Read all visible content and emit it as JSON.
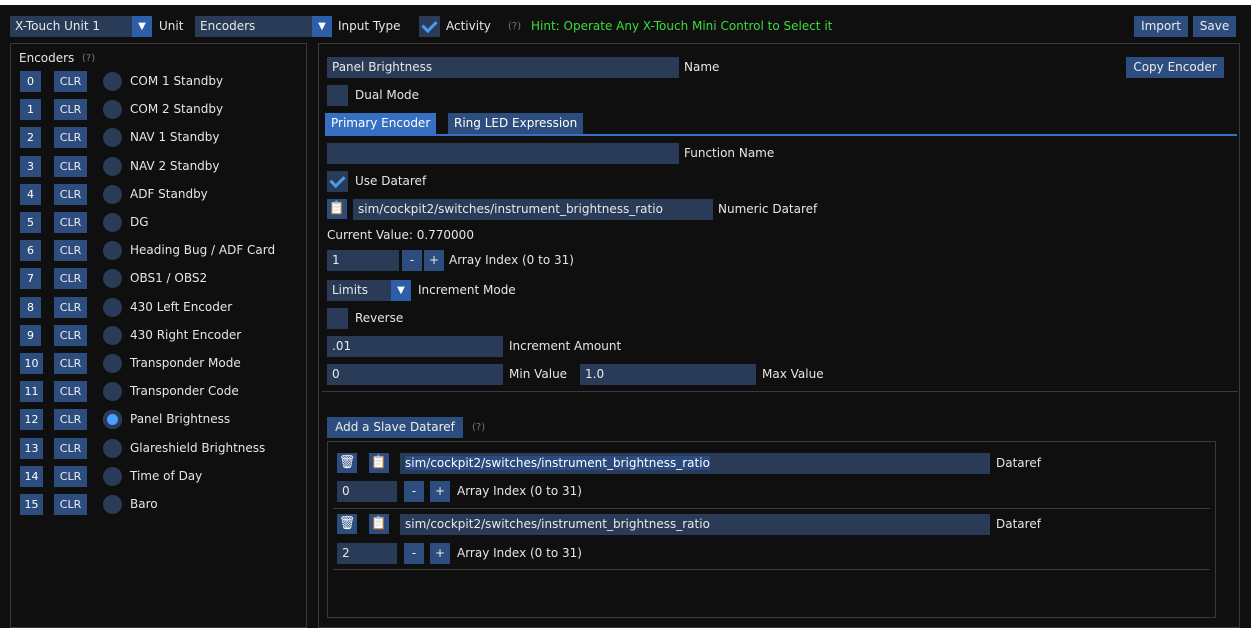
{
  "toolbar": {
    "unit_value": "X-Touch Unit 1",
    "unit_label": "Unit",
    "input_type_value": "Encoders",
    "input_type_label": "Input Type",
    "activity_label": "Activity",
    "help": "(?)",
    "hint": "Hint: Operate Any X-Touch Mini Control to Select it",
    "import_label": "Import",
    "save_label": "Save"
  },
  "sidebar": {
    "title": "Encoders",
    "help": "(?)",
    "clr_label": "CLR",
    "items": [
      {
        "index": "0",
        "name": "COM 1 Standby"
      },
      {
        "index": "1",
        "name": "COM 2 Standby"
      },
      {
        "index": "2",
        "name": "NAV 1 Standby"
      },
      {
        "index": "3",
        "name": "NAV 2 Standby"
      },
      {
        "index": "4",
        "name": "ADF Standby"
      },
      {
        "index": "5",
        "name": "DG"
      },
      {
        "index": "6",
        "name": "Heading Bug / ADF Card"
      },
      {
        "index": "7",
        "name": "OBS1 / OBS2"
      },
      {
        "index": "8",
        "name": "430 Left Encoder"
      },
      {
        "index": "9",
        "name": "430 Right Encoder"
      },
      {
        "index": "10",
        "name": "Transponder Mode"
      },
      {
        "index": "11",
        "name": "Transponder Code"
      },
      {
        "index": "12",
        "name": "Panel Brightness"
      },
      {
        "index": "13",
        "name": "Glareshield Brightness"
      },
      {
        "index": "14",
        "name": "Time of Day"
      },
      {
        "index": "15",
        "name": "Baro"
      }
    ],
    "selected_index": 12
  },
  "editor": {
    "name_value": "Panel Brightness",
    "name_label": "Name",
    "copy_label": "Copy Encoder",
    "dual_mode_label": "Dual Mode",
    "tabs": [
      "Primary Encoder",
      "Ring LED Expression"
    ],
    "function_name_value": "",
    "function_name_label": "Function Name",
    "use_dataref_label": "Use Dataref",
    "dataref_value": "sim/cockpit2/switches/instrument_brightness_ratio",
    "dataref_label": "Numeric Dataref",
    "current_value_text": "Current Value: 0.770000",
    "array_index_value": "1",
    "minus_label": "-",
    "plus_label": "+",
    "array_index_label": "Array Index (0 to 31)",
    "increment_mode_value": "Limits",
    "increment_mode_label": "Increment Mode",
    "reverse_label": "Reverse",
    "increment_amount_value": ".01",
    "increment_amount_label": "Increment Amount",
    "min_value": "0",
    "min_label": "Min Value",
    "max_value": "1.0",
    "max_label": "Max Value"
  },
  "slaves": {
    "add_label": "Add a Slave Dataref",
    "help": "(?)",
    "items": [
      {
        "dataref": "sim/cockpit2/switches/instrument_brightness_ratio",
        "dataref_label": "Dataref",
        "index": "0",
        "index_label": "Array Index (0 to 31)"
      },
      {
        "dataref": "sim/cockpit2/switches/instrument_brightness_ratio",
        "dataref_label": "Dataref",
        "index": "2",
        "index_label": "Array Index (0 to 31)"
      }
    ]
  },
  "colors": {
    "background": "#0f0f0f",
    "field": "#2a3b58",
    "button": "#2c4d7e",
    "accent": "#4aa0ff",
    "hint": "#3bdc3b"
  }
}
